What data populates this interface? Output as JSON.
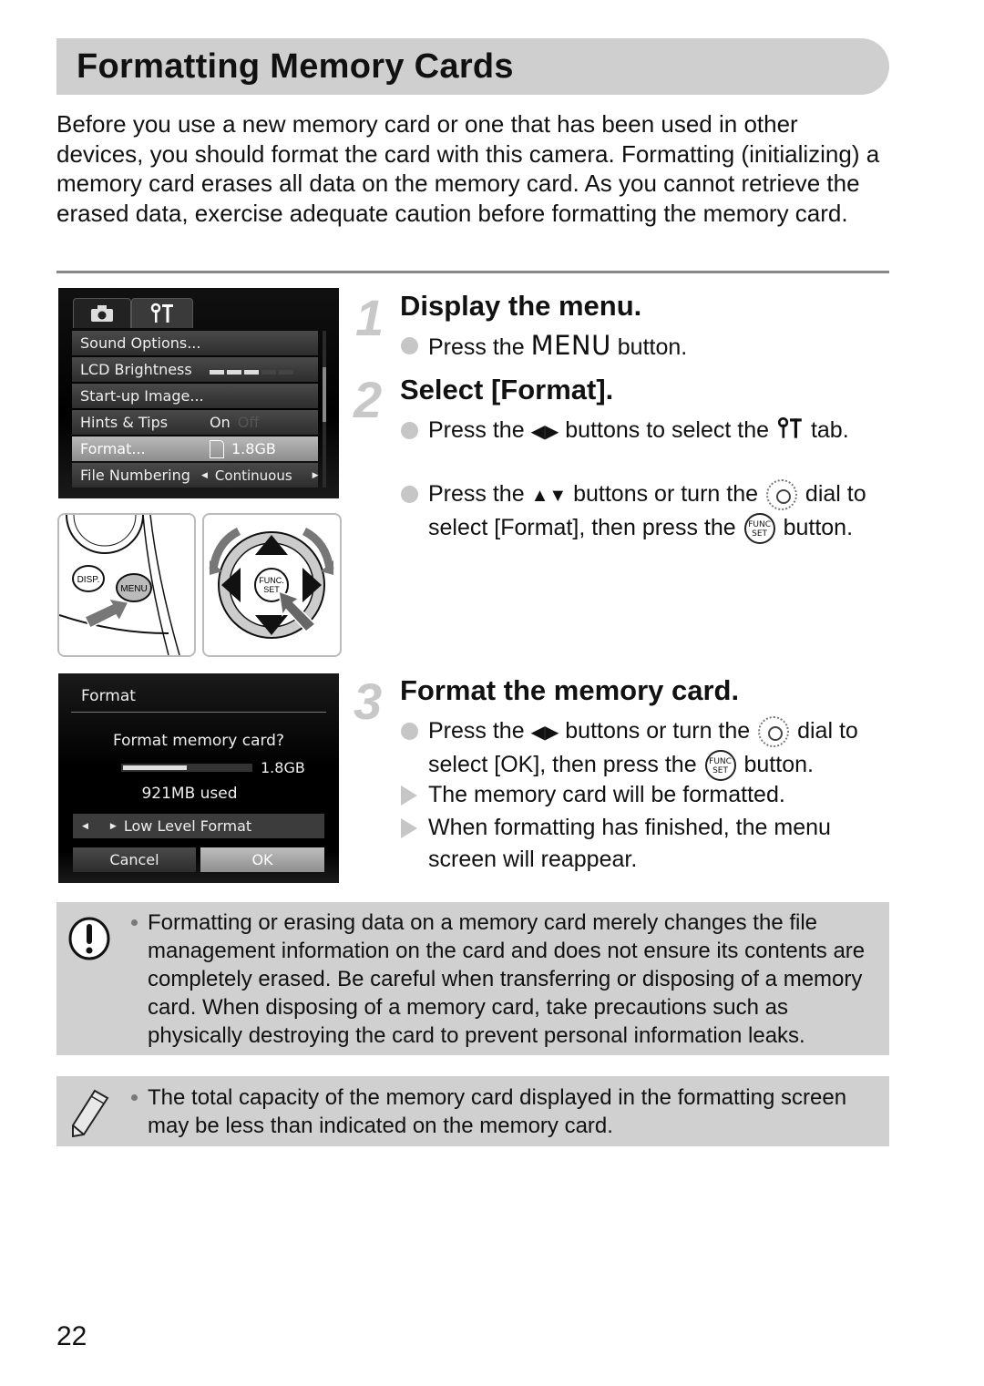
{
  "title": "Formatting Memory Cards",
  "intro": "Before you use a new memory card or one that has been used in other devices, you should format the card with this camera. Formatting (initializing) a memory card erases all data on the memory card. As you cannot retrieve the erased data, exercise adequate caution before formatting the memory card.",
  "menu_screen": {
    "tabs": [
      {
        "name": "camera-tab",
        "icon": "camera-icon",
        "glyph": "◘"
      },
      {
        "name": "tools-tab",
        "icon": "tools-icon",
        "glyph": "ϒ†"
      }
    ],
    "items": [
      {
        "label": "Sound Options...",
        "value": ""
      },
      {
        "label": "LCD Brightness",
        "value": "",
        "brightness_level": 3,
        "brightness_max": 5
      },
      {
        "label": "Start-up Image...",
        "value": ""
      },
      {
        "label": "Hints & Tips",
        "value": "On",
        "value_off": "Off"
      },
      {
        "label": "Format...",
        "value": "1.8GB",
        "selected": true
      },
      {
        "label": "File Numbering",
        "value": "Continuous"
      }
    ]
  },
  "format_screen": {
    "header": "Format",
    "question": "Format memory card?",
    "capacity": "1.8GB",
    "used_fraction": 0.5,
    "used": "921MB used",
    "low_level": "Low Level Format",
    "cancel": "Cancel",
    "ok": "OK"
  },
  "illustrations": {
    "button_labels": [
      "DISP.",
      "MENU"
    ],
    "dial_center": "FUNC. SET"
  },
  "steps": [
    {
      "number": "1",
      "title": "Display the menu.",
      "bullets": [
        {
          "type": "action",
          "pre": "Press the",
          "menu": "MENU",
          "post": "button."
        }
      ]
    },
    {
      "number": "2",
      "title": "Select [Format].",
      "bullets": [
        {
          "type": "action",
          "pre": "Press the",
          "arrows": "◀▶",
          "mid": "buttons to select the",
          "tab_glyph": "ϒ†",
          "post": "tab."
        },
        {
          "type": "action",
          "pre": "Press the",
          "arrows": "▲▼",
          "mid": "buttons or turn the",
          "post1": "dial to select [Format], then press the",
          "post2": "button."
        }
      ]
    },
    {
      "number": "3",
      "title": "Format the memory card.",
      "bullets": [
        {
          "type": "action",
          "pre": "Press the",
          "arrows": "◀▶",
          "mid": "buttons or turn the",
          "post1": "dial to select [OK], then press the",
          "post2": "button."
        },
        {
          "type": "result",
          "text": "The memory card will be formatted."
        },
        {
          "type": "result",
          "text": "When formatting has finished, the menu screen will reappear."
        }
      ]
    }
  ],
  "func_label": [
    "FUNC",
    "SET"
  ],
  "notes": [
    {
      "icon": "caution-icon",
      "text": "Formatting or erasing data on a memory card merely changes the file management information on the card and does not ensure its contents are completely erased. Be careful when transferring or disposing of a memory card. When disposing of a memory card, take precautions such as physically destroying the card to prevent personal information leaks."
    },
    {
      "icon": "pencil-icon",
      "text": "The total capacity of the memory card displayed in the formatting screen may be less than indicated on the memory card."
    }
  ],
  "page_number": "22"
}
